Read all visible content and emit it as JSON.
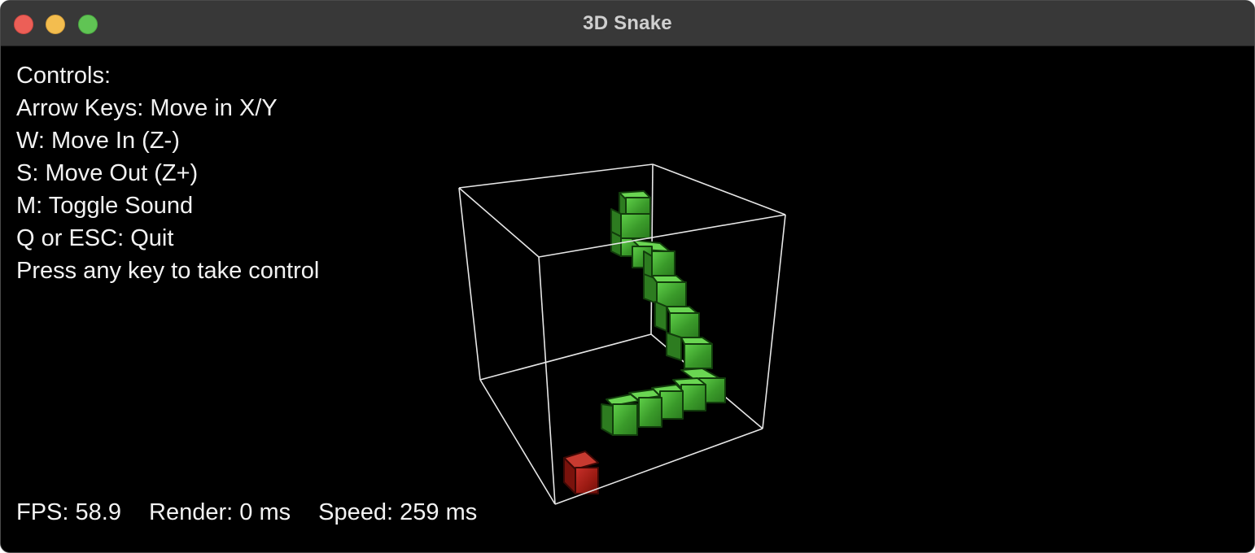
{
  "window": {
    "title": "3D Snake"
  },
  "controls": {
    "heading": "Controls:",
    "lines": [
      "Arrow Keys: Move in X/Y",
      "W: Move In (Z-)",
      "S: Move Out (Z+)",
      "M: Toggle Sound",
      "Q or ESC: Quit",
      "Press any key to take control"
    ]
  },
  "stats": {
    "fps": "FPS: 58.9",
    "render": "Render: 0 ms",
    "speed": "Speed: 259 ms"
  },
  "game": {
    "snake_segments": 15,
    "food_count": 1
  },
  "colors": {
    "background": "#000000",
    "titlebar": "#383838",
    "cage_lines": "#e6e6e6",
    "snake": "#3c9a2c",
    "food": "#a01c12"
  }
}
